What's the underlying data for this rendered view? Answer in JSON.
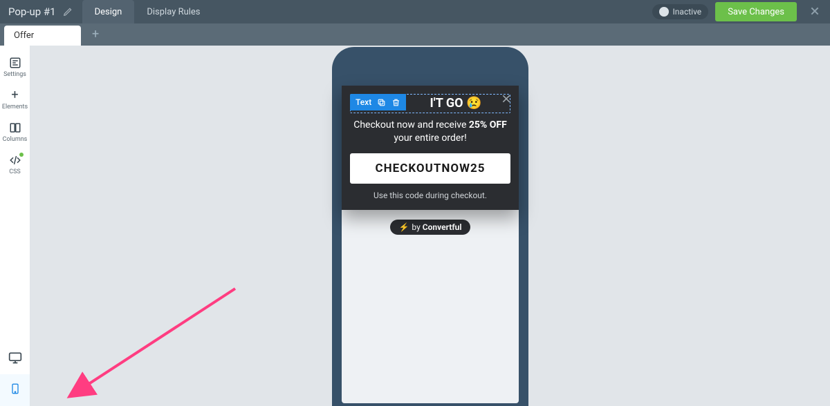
{
  "header": {
    "title": "Pop-up #1",
    "tabs": {
      "design": "Design",
      "rules": "Display Rules"
    },
    "status_label": "Inactive",
    "save_label": "Save Changes"
  },
  "subtabs": {
    "current": "Offer"
  },
  "rail": {
    "settings": "Settings",
    "elements": "Elements",
    "columns": "Columns",
    "css": "CSS"
  },
  "popup": {
    "selection_label": "Text",
    "headline_visible": "I'T GO 😢",
    "subtext_pre": "Checkout now and receive ",
    "subtext_bold": "25% OFF",
    "subtext_post": " your entire order!",
    "coupon": "CHECKOUTNOW25",
    "hint": "Use this code during checkout.",
    "branding_prefix": "by ",
    "branding_name": "Convertful"
  }
}
